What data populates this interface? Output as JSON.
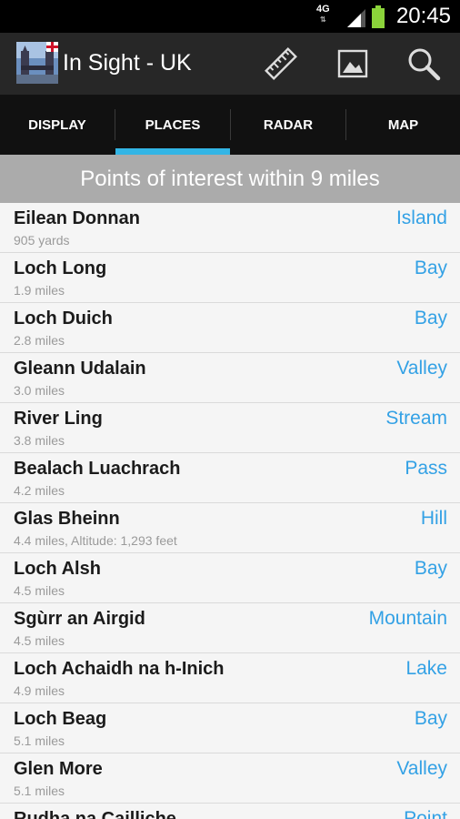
{
  "status_bar": {
    "network": "4G",
    "time": "20:45"
  },
  "app": {
    "title": "In Sight - UK",
    "actions": [
      "ruler-icon",
      "image-icon",
      "search-icon"
    ]
  },
  "tabs": [
    {
      "label": "DISPLAY",
      "selected": false
    },
    {
      "label": "PLACES",
      "selected": true
    },
    {
      "label": "RADAR",
      "selected": false
    },
    {
      "label": "MAP",
      "selected": false
    }
  ],
  "header": {
    "text": "Points of interest within 9 miles"
  },
  "places": [
    {
      "name": "Eilean Donnan",
      "detail": "905 yards",
      "type": "Island"
    },
    {
      "name": "Loch Long",
      "detail": "1.9 miles",
      "type": "Bay"
    },
    {
      "name": "Loch Duich",
      "detail": "2.8 miles",
      "type": "Bay"
    },
    {
      "name": "Gleann Udalain",
      "detail": "3.0 miles",
      "type": "Valley"
    },
    {
      "name": "River Ling",
      "detail": "3.8 miles",
      "type": "Stream"
    },
    {
      "name": "Bealach Luachrach",
      "detail": "4.2 miles",
      "type": "Pass"
    },
    {
      "name": "Glas Bheinn",
      "detail": "4.4 miles, Altitude: 1,293 feet",
      "type": "Hill"
    },
    {
      "name": "Loch Alsh",
      "detail": "4.5 miles",
      "type": "Bay"
    },
    {
      "name": "Sgùrr an Airgid",
      "detail": "4.5 miles",
      "type": "Mountain"
    },
    {
      "name": "Loch Achaidh na h-Inich",
      "detail": "4.9 miles",
      "type": "Lake"
    },
    {
      "name": "Loch Beag",
      "detail": "5.1 miles",
      "type": "Bay"
    },
    {
      "name": "Glen More",
      "detail": "5.1 miles",
      "type": "Valley"
    },
    {
      "name": "Rudha na Cailliche",
      "detail": "",
      "type": "Point"
    }
  ],
  "colors": {
    "accent": "#33b5e5",
    "type_text": "#33a1e5",
    "header_bg": "#ababab",
    "action_bar": "#272727",
    "tab_bar": "#111111"
  }
}
